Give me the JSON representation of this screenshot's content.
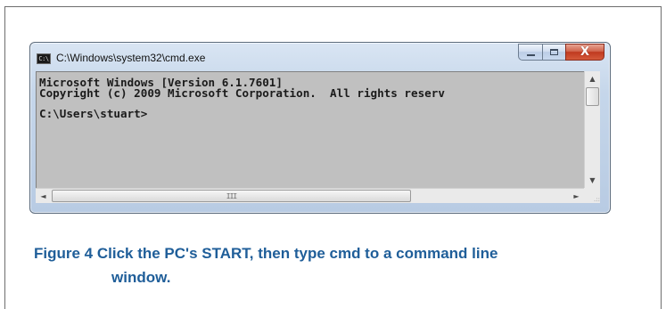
{
  "window": {
    "title": "C:\\Windows\\system32\\cmd.exe",
    "app_icon_text": "C:\\",
    "controls": {
      "minimize": "minimize-icon",
      "maximize": "maximize-icon",
      "close": "close-icon",
      "close_glyph": "X"
    }
  },
  "console": {
    "lines": [
      "Microsoft Windows [Version 6.1.7601]",
      "Copyright (c) 2009 Microsoft Corporation.  All rights reserv",
      "",
      "C:\\Users\\stuart>"
    ]
  },
  "scrollbars": {
    "vertical": {
      "up_glyph": "▲",
      "down_glyph": "▼"
    },
    "horizontal": {
      "left_glyph": "◄",
      "right_glyph": "►",
      "thumb_grip": "III"
    },
    "resize_grip": ".::"
  },
  "caption": {
    "line1": "Figure 4 Click the PC's START, then type cmd to a command line",
    "line2": "window."
  },
  "colors": {
    "caption": "#1f5e99",
    "console_bg": "#c0c0c0",
    "close_button": "#c0391f"
  }
}
